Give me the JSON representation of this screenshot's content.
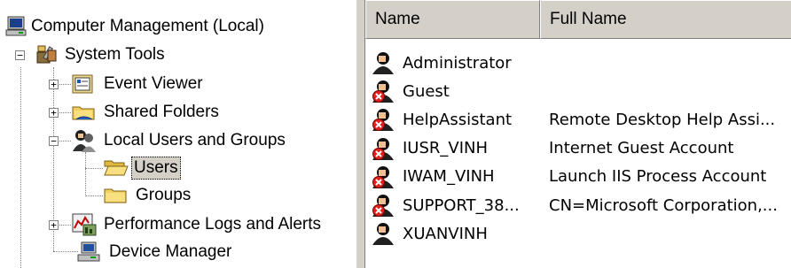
{
  "tree": {
    "root": {
      "label": "Computer Management (Local)",
      "icon": "computer-icon"
    },
    "system_tools": {
      "label": "System Tools",
      "icon": "tools-icon",
      "expander": "−"
    },
    "event_viewer": {
      "label": "Event Viewer",
      "icon": "event-viewer-icon",
      "expander": "+"
    },
    "shared_folders": {
      "label": "Shared Folders",
      "icon": "shared-folder-icon",
      "expander": "+"
    },
    "local_users": {
      "label": "Local Users and Groups",
      "icon": "users-groups-icon",
      "expander": "−"
    },
    "users": {
      "label": "Users",
      "icon": "open-folder-icon",
      "selected": true
    },
    "groups": {
      "label": "Groups",
      "icon": "folder-icon"
    },
    "perf_logs": {
      "label": "Performance Logs and Alerts",
      "icon": "performance-icon",
      "expander": "+"
    },
    "device_manager": {
      "label": "Device Manager",
      "icon": "device-manager-icon"
    }
  },
  "list": {
    "columns": [
      "Name",
      "Full Name"
    ],
    "rows": [
      {
        "name": "Administrator",
        "full": "",
        "disabled": false
      },
      {
        "name": "Guest",
        "full": "",
        "disabled": true
      },
      {
        "name": "HelpAssistant",
        "full": "Remote Desktop Help Assi...",
        "disabled": true
      },
      {
        "name": "IUSR_VINH",
        "full": "Internet Guest Account",
        "disabled": true
      },
      {
        "name": "IWAM_VINH",
        "full": "Launch IIS Process Account",
        "disabled": true
      },
      {
        "name": "SUPPORT_38...",
        "full": "CN=Microsoft Corporation,...",
        "disabled": true
      },
      {
        "name": "XUANVINH",
        "full": "",
        "disabled": false
      }
    ]
  },
  "colors": {
    "selection": "#d4d0c8",
    "header_bg": "#d4d0c8",
    "disabled_badge": "#e0201c"
  }
}
